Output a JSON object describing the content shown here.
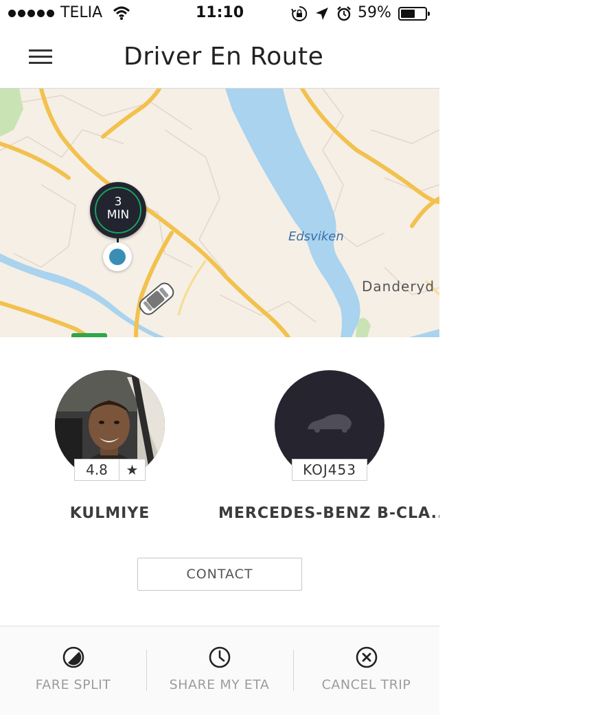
{
  "status_bar": {
    "carrier": "TELIA",
    "time": "11:10",
    "battery_percent": "59%",
    "battery_level": 0.59,
    "icons": [
      "signal-dots-icon",
      "wifi-icon",
      "rotation-lock-icon",
      "location-arrow-icon",
      "alarm-icon",
      "battery-icon"
    ]
  },
  "nav": {
    "title": "Driver En Route",
    "menu_icon": "hamburger-menu-icon"
  },
  "map": {
    "eta_value": "3",
    "eta_unit": "MIN",
    "labels": {
      "water": "Edsviken",
      "place": "Danderyd"
    },
    "colors": {
      "land": "#f6efe5",
      "water": "#a9d3ee",
      "road": "#f2c14e",
      "park": "#c9e3b5"
    }
  },
  "driver": {
    "name": "KULMIYE",
    "rating": "4.8",
    "rating_icon": "star-icon"
  },
  "vehicle": {
    "name": "MERCEDES-BENZ  B-CLA...",
    "plate": "KOJ453",
    "icon": "car-silhouette-icon"
  },
  "contact": {
    "label": "CONTACT"
  },
  "actions": [
    {
      "label": "FARE SPLIT",
      "icon": "fare-split-icon"
    },
    {
      "label": "SHARE MY ETA",
      "icon": "clock-icon"
    },
    {
      "label": "CANCEL TRIP",
      "icon": "cancel-circle-icon"
    }
  ]
}
